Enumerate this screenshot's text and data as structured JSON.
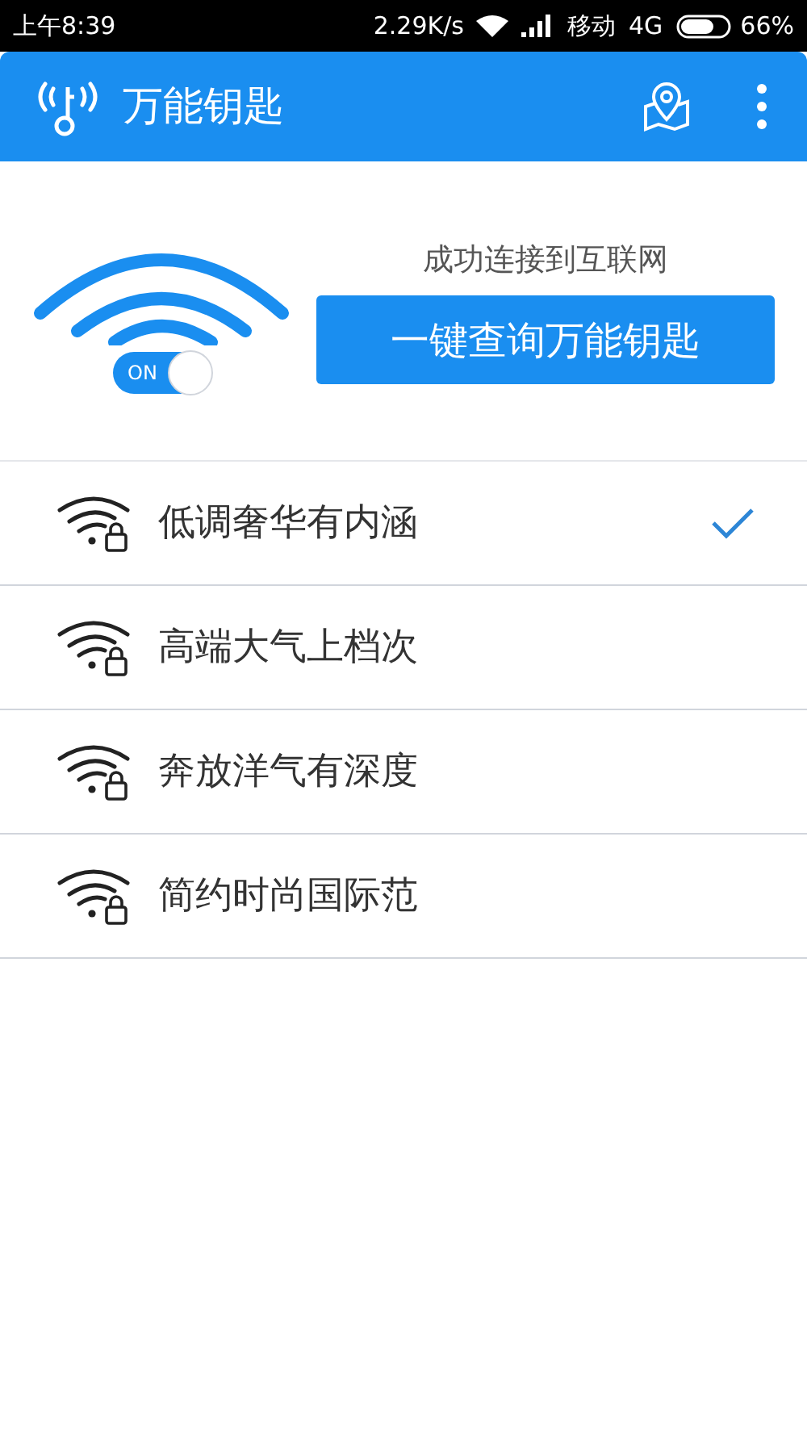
{
  "status_bar": {
    "time": "上午8:39",
    "speed": "2.29K/s",
    "carrier": "移动",
    "network": "4G",
    "battery": "66%"
  },
  "app_bar": {
    "title": "万能钥匙"
  },
  "hero": {
    "switch": {
      "label": "ON",
      "on": true
    },
    "status": "成功连接到互联网",
    "button": "一键查询万能钥匙"
  },
  "networks": [
    {
      "name": "低调奢华有内涵",
      "selected": true
    },
    {
      "name": "高端大气上档次",
      "selected": false
    },
    {
      "name": "奔放洋气有深度",
      "selected": false
    },
    {
      "name": "简约时尚国际范",
      "selected": false
    }
  ]
}
